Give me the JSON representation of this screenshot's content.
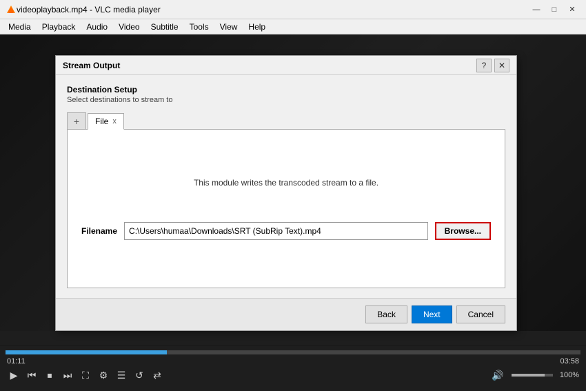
{
  "titlebar": {
    "title": "videoplayback.mp4 - VLC media player",
    "icon": "▶",
    "minimize": "—",
    "maximize": "□",
    "close": "✕"
  },
  "menubar": {
    "items": [
      "Media",
      "Playback",
      "Audio",
      "Video",
      "Subtitle",
      "Tools",
      "View",
      "Help"
    ]
  },
  "dialog": {
    "title": "Stream Output",
    "help": "?",
    "close": "✕",
    "section_title": "Destination Setup",
    "section_subtitle": "Select destinations to stream to",
    "tab_add": "+",
    "tab_label": "File",
    "tab_close": "x",
    "module_description": "This module writes the transcoded stream to a file.",
    "filename_label": "Filename",
    "filename_value": "C:\\Users\\humaa\\Downloads\\SRT (SubRip Text).mp4",
    "browse_label": "Browse...",
    "back_label": "Back",
    "next_label": "Next",
    "cancel_label": "Cancel"
  },
  "playback": {
    "time_current": "01:11",
    "time_total": "03:58",
    "progress_percent": 28,
    "volume_percent": 100,
    "volume_label": "100%"
  }
}
